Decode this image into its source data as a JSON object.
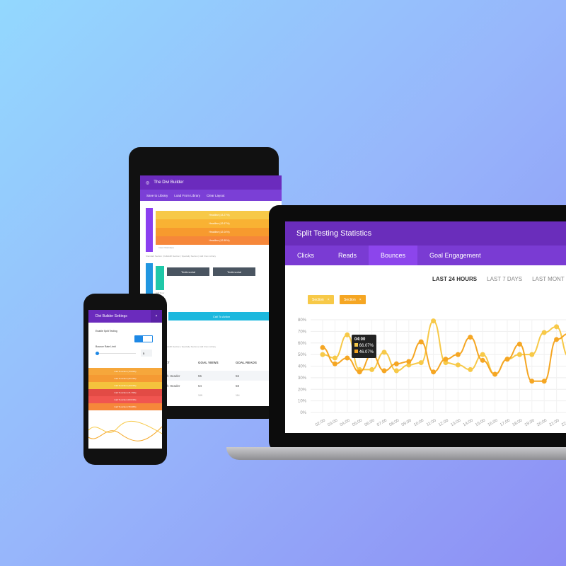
{
  "tablet": {
    "title": "The Divi Builder",
    "toolbar": [
      "Save to Library",
      "Load From Library",
      "Clear Layout"
    ],
    "headlines": [
      "Headline (43.27%)",
      "Headline (42.67%)",
      "Headline (42.04%)",
      "Headline (42.85%)"
    ],
    "insert_module": "Insert Module(s)",
    "add_row": "Add Row",
    "section_links": "Standard Section | Fullwidth Section | Specialty Section | Add From Library",
    "testimonial": "Testimonial",
    "cta": "Call To Action",
    "table": {
      "headers": [
        "JECT",
        "GOAL VIEWS",
        "GOAL READS",
        "E"
      ],
      "rows": [
        [
          "width Header",
          "55",
          "56"
        ],
        [
          "width Header",
          "54",
          "58"
        ],
        [
          "",
          "109",
          "114"
        ]
      ]
    },
    "colors": {
      "headlines": [
        "#f7c948",
        "#f9b233",
        "#f79a2e",
        "#f6873a"
      ]
    }
  },
  "laptop": {
    "title": "Split Testing Statistics",
    "tabs": [
      "Clicks",
      "Reads",
      "Bounces",
      "Goal Engagement"
    ],
    "active_tab": "Bounces",
    "ranges": [
      "LAST 24 HOURS",
      "LAST 7 DAYS",
      "LAST MONT"
    ],
    "chips": [
      "Section",
      "Section"
    ],
    "tooltip": {
      "time": "04:00",
      "a": "66.07%",
      "b": "46.07%"
    }
  },
  "chart_data": {
    "type": "line",
    "categories": [
      "02:00",
      "03:00",
      "04:00",
      "05:00",
      "06:00",
      "07:00",
      "08:00",
      "09:00",
      "10:00",
      "11:00",
      "12:00",
      "13:00",
      "14:00",
      "15:00",
      "16:00",
      "17:00",
      "18:00",
      "19:00",
      "20:00",
      "21:00",
      "22:00"
    ],
    "ylim": [
      0,
      80
    ],
    "yticks": [
      "0%",
      "10%",
      "20%",
      "30%",
      "40%",
      "50%",
      "60%",
      "70%",
      "80%"
    ],
    "grid": true,
    "series": [
      {
        "color": "#f7c948",
        "values": [
          50,
          47,
          67,
          37,
          37,
          52,
          36,
          41,
          43,
          79,
          43,
          41,
          37,
          50,
          33,
          46,
          50,
          50,
          69,
          74,
          48
        ]
      },
      {
        "color": "#f5a623",
        "values": [
          56,
          42,
          47,
          35,
          50,
          36,
          42,
          44,
          61,
          35,
          46,
          50,
          65,
          45,
          33,
          46,
          59,
          27,
          27,
          63,
          68
        ]
      }
    ]
  },
  "phone": {
    "title": "Divi Builder Settings",
    "close": "×",
    "split_label": "Enable Split Testing",
    "bounce_label": "Bounce Rate Limit",
    "bounce_value": "5",
    "rows": [
      "Call To Action (73.99%)",
      "Call To Action (33.43%)",
      "Call To Action (13.03%)",
      "Call To Action (71.79%)",
      "Call To Action (63.63%)",
      "Call To Action (79.08%)"
    ],
    "row_colors": [
      "#f6a73b",
      "#f59a33",
      "#f4c23d",
      "#e24b45",
      "#f05550",
      "#f6873a"
    ]
  }
}
